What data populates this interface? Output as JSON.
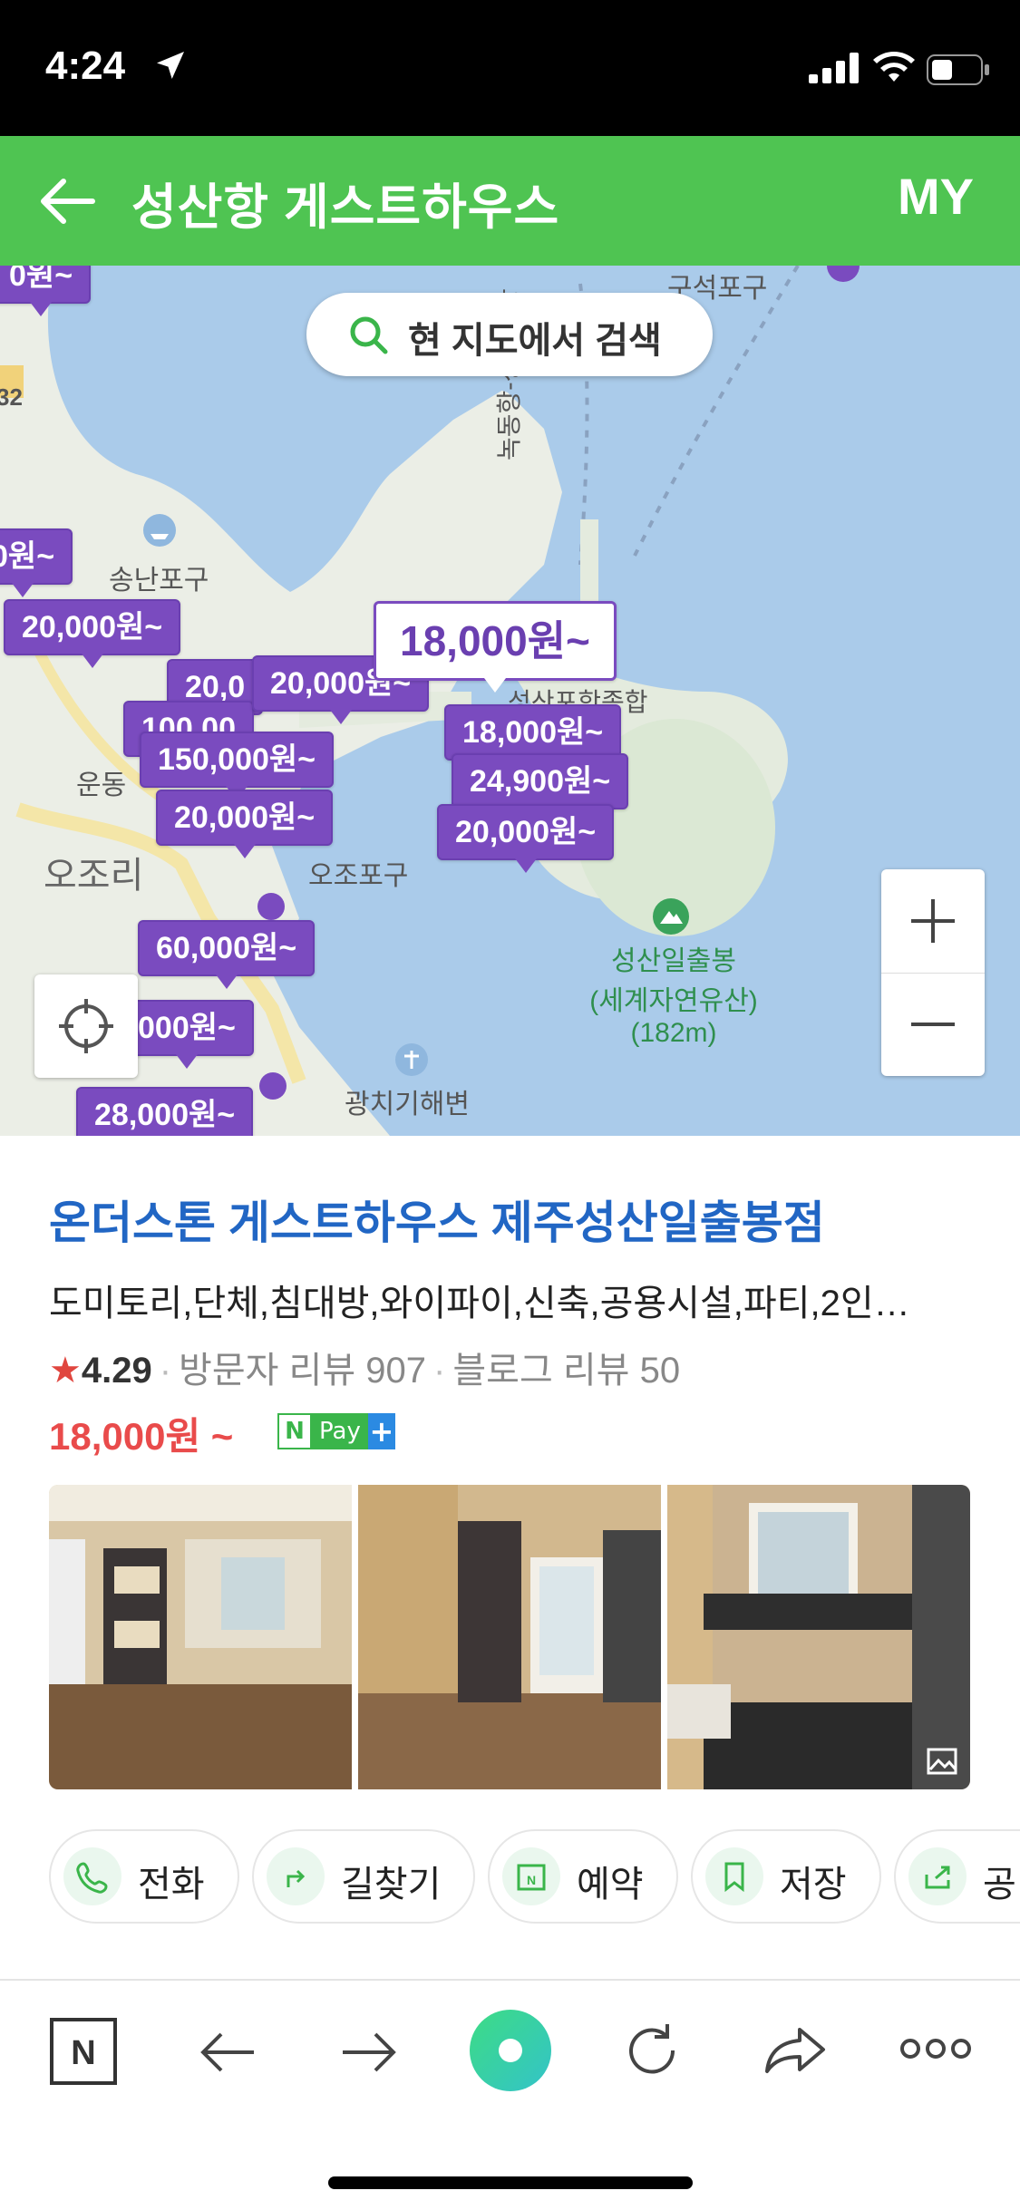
{
  "status_bar": {
    "time": "4:24"
  },
  "header": {
    "title": "성산항 게스트하우스",
    "my_label": "MY"
  },
  "map": {
    "search_label": "현 지도에서 검색",
    "place_labels": {
      "guseok": "구석포구",
      "songnan": "송난포구",
      "undong": "운동",
      "ojori": "오조리",
      "ojo_port": "오조포구",
      "gwangchi": "광치기해변",
      "route": "녹동항-성산포항",
      "road_no": "32",
      "seongsan_ferry": "성산포항종합",
      "seongsan_name": "성산일출봉",
      "seongsan_sub": "(세계자연유산)",
      "seongsan_height": "(182m)"
    },
    "pins": {
      "p0": "0원~",
      "p1": "20,000원~",
      "p2": "20,0",
      "p3": "20,000원~",
      "p4": "100,00",
      "p5": "150,000원~",
      "p6": "20,000원~",
      "p7": "18,000원~",
      "p8": "24,900원~",
      "p9": "20,000원~",
      "p10": "60,000원~",
      "p11": "000원~",
      "p12": "28,000원~",
      "selected": "18,000원~",
      "top_partial": "0원~"
    }
  },
  "listing": {
    "name": "온더스톤 게스트하우스 제주성산일출봉점",
    "tags": "도미토리,단체,침대방,와이파이,신축,공용시설,파티,2인…",
    "rating": "4.29",
    "visitor_reviews": "방문자 리뷰 907",
    "blog_reviews": "블로그 리뷰 50",
    "price": "18,000원 ~",
    "npay": {
      "n": "N",
      "pay": "Pay",
      "plus": "+"
    },
    "actions": [
      "전화",
      "길찾기",
      "예약",
      "저장",
      "공"
    ]
  },
  "colors": {
    "header": "#4fc452",
    "pin": "#7a4bbf",
    "name": "#2166c4",
    "price": "#e94b4b"
  }
}
